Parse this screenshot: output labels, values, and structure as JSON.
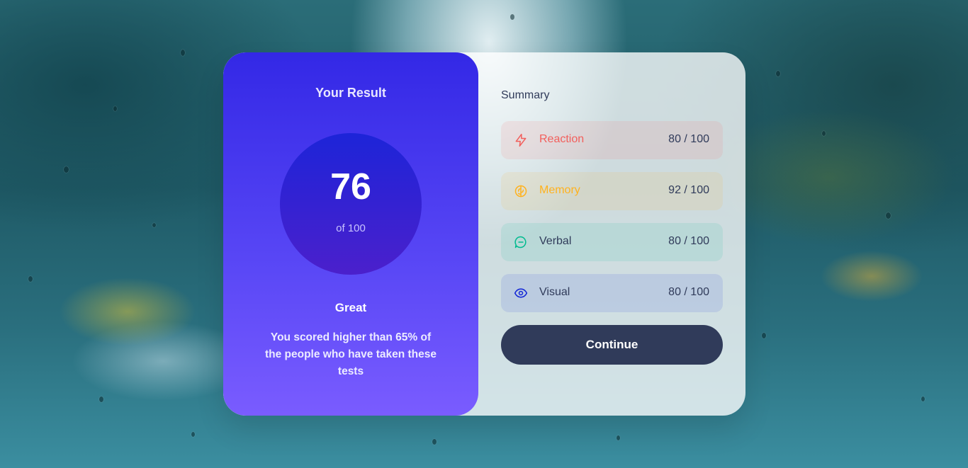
{
  "result": {
    "title": "Your Result",
    "score": "76",
    "score_of": "of 100",
    "rating": "Great",
    "description": "You scored higher than 65% of the people who have taken these tests"
  },
  "summary": {
    "title": "Summary",
    "items": [
      {
        "label": "Reaction",
        "score": "80 / 100",
        "icon": "lightning-icon",
        "color": "#f25f5c",
        "bg": "rgba(255,87,87,0.10)"
      },
      {
        "label": "Memory",
        "score": "92 / 100",
        "icon": "brain-icon",
        "color": "#ffb21e",
        "bg": "rgba(255,176,31,0.10)"
      },
      {
        "label": "Verbal",
        "score": "80 / 100",
        "icon": "chat-bubble-icon",
        "color": "#00bb8f",
        "bg": "rgba(0,187,143,0.10)"
      },
      {
        "label": "Visual",
        "score": "80 / 100",
        "icon": "eye-icon",
        "color": "#1125d6",
        "bg": "rgba(17,37,214,0.10)"
      }
    ]
  },
  "continue_label": "Continue"
}
